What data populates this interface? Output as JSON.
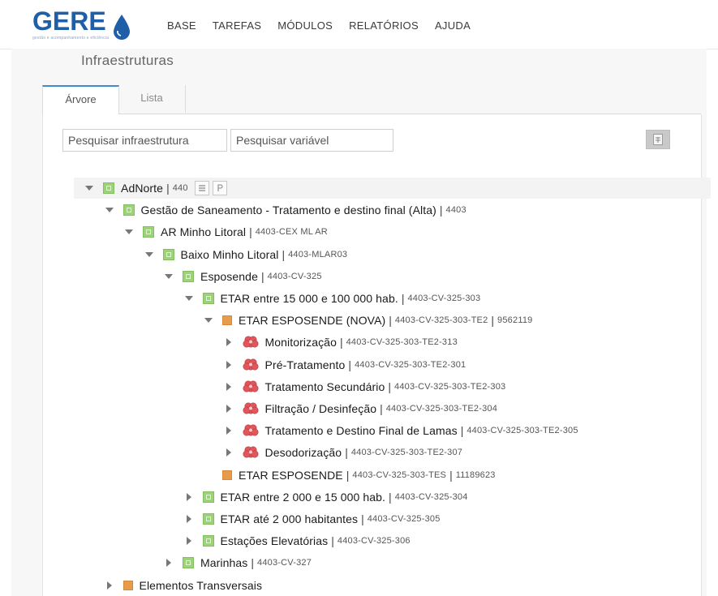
{
  "app": {
    "logo_text": "GERE",
    "logo_subtitle": "gestão e acompanhamento e eficiência",
    "brand_color": "#1f5fa8"
  },
  "menu": [
    "BASE",
    "TAREFAS",
    "MÓDULOS",
    "RELATÓRIOS",
    "AJUDA"
  ],
  "page": {
    "title": "Infraestruturas"
  },
  "tabs": [
    {
      "label": "Árvore",
      "active": true
    },
    {
      "label": "Lista",
      "active": false
    }
  ],
  "search": {
    "infra_placeholder": "Pesquisar infraestrutura",
    "var_placeholder": "Pesquisar variável"
  },
  "colors": {
    "green_node": "#9bd27a",
    "orange_node": "#e89b4a",
    "process_node": "#e0565b",
    "tab_accent": "#3c8dcf"
  },
  "tree": [
    {
      "label": "AdNorte",
      "code": "440",
      "icon": "green-square-icon",
      "toggle": "expanded",
      "level": 0,
      "extra": ""
    },
    {
      "label": "Gestão de Saneamento - Tratamento e destino final (Alta)",
      "code": "4403",
      "icon": "green-square-icon",
      "toggle": "expanded",
      "level": 1,
      "extra": ""
    },
    {
      "label": "AR Minho Litoral",
      "code": "4403-CEX ML AR",
      "icon": "green-square-icon",
      "toggle": "expanded",
      "level": 2,
      "extra": ""
    },
    {
      "label": "Baixo Minho Litoral",
      "code": "4403-MLAR03",
      "icon": "green-square-icon",
      "toggle": "expanded",
      "level": 3,
      "extra": ""
    },
    {
      "label": "Esposende",
      "code": "4403-CV-325",
      "icon": "green-square-icon",
      "toggle": "expanded",
      "level": 4,
      "extra": ""
    },
    {
      "label": "ETAR entre 15 000 e 100 000 hab.",
      "code": "4403-CV-325-303",
      "icon": "green-square-icon",
      "toggle": "expanded",
      "level": 5,
      "extra": ""
    },
    {
      "label": "ETAR ESPOSENDE (NOVA)",
      "code": "4403-CV-325-303-TE2",
      "icon": "orange-square-icon",
      "toggle": "expanded",
      "level": 6,
      "extra": "9562119"
    },
    {
      "label": "Monitorização",
      "code": "4403-CV-325-303-TE2-313",
      "icon": "process-flower-icon",
      "toggle": "collapsed",
      "level": 7,
      "extra": ""
    },
    {
      "label": "Pré-Tratamento",
      "code": "4403-CV-325-303-TE2-301",
      "icon": "process-flower-icon",
      "toggle": "collapsed",
      "level": 7,
      "extra": ""
    },
    {
      "label": "Tratamento Secundário",
      "code": "4403-CV-325-303-TE2-303",
      "icon": "process-flower-icon",
      "toggle": "collapsed",
      "level": 7,
      "extra": ""
    },
    {
      "label": "Filtração / Desinfeção",
      "code": "4403-CV-325-303-TE2-304",
      "icon": "process-flower-icon",
      "toggle": "collapsed",
      "level": 7,
      "extra": ""
    },
    {
      "label": "Tratamento e Destino Final de Lamas",
      "code": "4403-CV-325-303-TE2-305",
      "icon": "process-flower-icon",
      "toggle": "collapsed",
      "level": 7,
      "extra": ""
    },
    {
      "label": "Desodorização",
      "code": "4403-CV-325-303-TE2-307",
      "icon": "process-flower-icon",
      "toggle": "collapsed",
      "level": 7,
      "extra": ""
    },
    {
      "label": "ETAR ESPOSENDE",
      "code": "4403-CV-325-303-TES",
      "icon": "orange-square-icon",
      "toggle": "none",
      "level": 6,
      "extra": "11189623"
    },
    {
      "label": "ETAR entre 2 000 e 15 000 hab.",
      "code": "4403-CV-325-304",
      "icon": "green-square-icon",
      "toggle": "collapsed",
      "level": 5,
      "extra": ""
    },
    {
      "label": "ETAR até 2 000 habitantes",
      "code": "4403-CV-325-305",
      "icon": "green-square-icon",
      "toggle": "collapsed",
      "level": 5,
      "extra": ""
    },
    {
      "label": "Estações Elevatórias",
      "code": "4403-CV-325-306",
      "icon": "green-square-icon",
      "toggle": "collapsed",
      "level": 5,
      "extra": ""
    },
    {
      "label": "Marinhas",
      "code": "4403-CV-327",
      "icon": "green-square-icon",
      "toggle": "collapsed",
      "level": 4,
      "extra": ""
    },
    {
      "label": "Elementos Transversais",
      "code": "",
      "icon": "orange-square-icon",
      "toggle": "collapsed",
      "level": 1,
      "extra": ""
    }
  ]
}
